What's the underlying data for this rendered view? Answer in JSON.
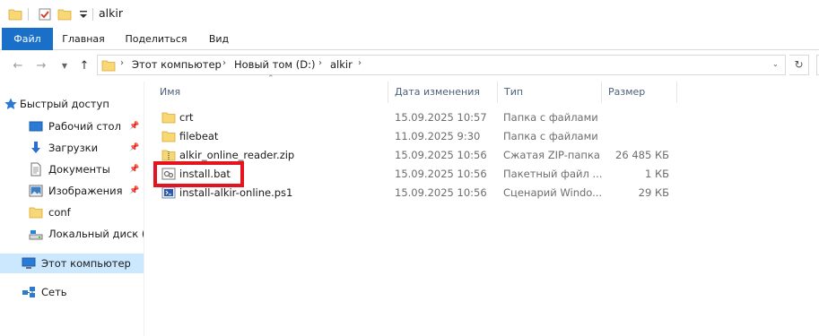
{
  "window": {
    "title": "alkir"
  },
  "ribbon": {
    "tabs": [
      "Файл",
      "Главная",
      "Поделиться",
      "Вид"
    ]
  },
  "address": {
    "segments": [
      "Этот компьютер",
      "Новый том (D:)",
      "alkir"
    ]
  },
  "nav": {
    "items": [
      {
        "label": "Быстрый доступ",
        "icon": "star-icon"
      },
      {
        "label": "Рабочий стол",
        "icon": "desktop-icon",
        "pinned": true
      },
      {
        "label": "Загрузки",
        "icon": "download-icon",
        "pinned": true
      },
      {
        "label": "Документы",
        "icon": "document-icon",
        "pinned": true
      },
      {
        "label": "Изображения",
        "icon": "pictures-icon",
        "pinned": true
      },
      {
        "label": "conf",
        "icon": "folder-icon"
      },
      {
        "label": "Локальный диск (C",
        "icon": "drive-icon"
      },
      {
        "label": "Этот компьютер",
        "icon": "computer-icon",
        "selected": true
      },
      {
        "label": "Сеть",
        "icon": "network-icon"
      }
    ]
  },
  "columns": {
    "name": "Имя",
    "date": "Дата изменения",
    "type": "Тип",
    "size": "Размер"
  },
  "files": [
    {
      "name": "crt",
      "date": "15.09.2025 10:57",
      "type": "Папка с файлами",
      "size": "",
      "icon": "folder-icon"
    },
    {
      "name": "filebeat",
      "date": "11.09.2025 9:30",
      "type": "Папка с файлами",
      "size": "",
      "icon": "folder-icon"
    },
    {
      "name": "alkir_online_reader.zip",
      "date": "15.09.2025 10:56",
      "type": "Сжатая ZIP-папка",
      "size": "26 485 КБ",
      "icon": "zip-icon"
    },
    {
      "name": "install.bat",
      "date": "15.09.2025 10:56",
      "type": "Пакетный файл ...",
      "size": "1 КБ",
      "icon": "batch-file-icon",
      "highlighted": true
    },
    {
      "name": "install-alkir-online.ps1",
      "date": "15.09.2025 10:56",
      "type": "Сценарий Windo...",
      "size": "29 КБ",
      "icon": "powershell-icon"
    }
  ],
  "colors": {
    "accent": "#1a6fc8",
    "selection": "#cce8ff",
    "highlight_box": "#e3141d",
    "folder": "#f8d775"
  }
}
